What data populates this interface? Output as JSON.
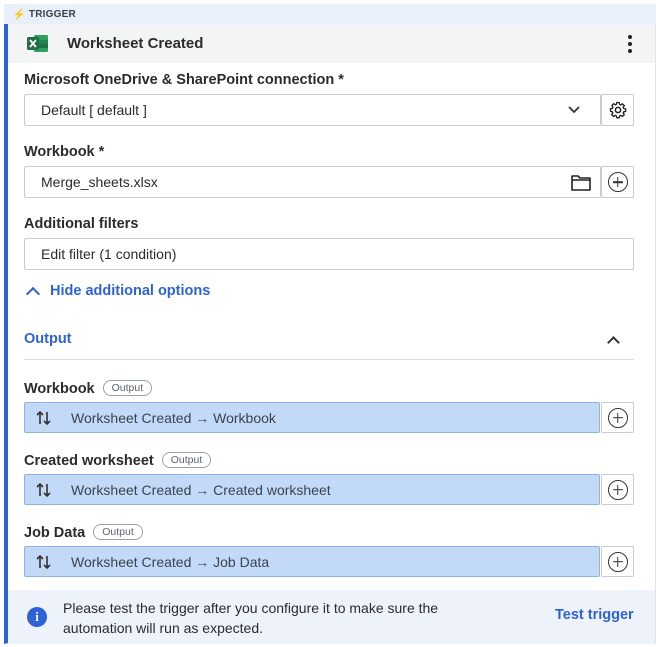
{
  "trigger_tag": "TRIGGER",
  "header": {
    "title": "Worksheet Created",
    "app_icon": "excel-icon",
    "menu_icon": "kebab-icon"
  },
  "connection": {
    "label": "Microsoft OneDrive & SharePoint connection *",
    "value": "Default [ default ]",
    "icons": [
      "chevron-down-icon",
      "gear-icon"
    ]
  },
  "workbook": {
    "label": "Workbook *",
    "value": "Merge_sheets.xlsx",
    "icons": [
      "folder-icon",
      "plus-circle-icon"
    ]
  },
  "filters": {
    "label": "Additional filters",
    "value": "Edit filter (1 condition)"
  },
  "toggle_link": "Hide additional options",
  "output": {
    "title": "Output",
    "badge": "Output",
    "fields": [
      {
        "label": "Workbook",
        "value": "Worksheet Created → Workbook"
      },
      {
        "label": "Created worksheet",
        "value": "Worksheet Created → Created worksheet"
      },
      {
        "label": "Job Data",
        "value": "Worksheet Created → Job Data"
      }
    ]
  },
  "info": {
    "text": "Please test the trigger after you configure it to make sure the automation will run as expected.",
    "button": "Test trigger"
  },
  "colors": {
    "accent": "#2e63d8",
    "output_fill": "#c2d9f8",
    "excel_green": "#1e7145"
  }
}
